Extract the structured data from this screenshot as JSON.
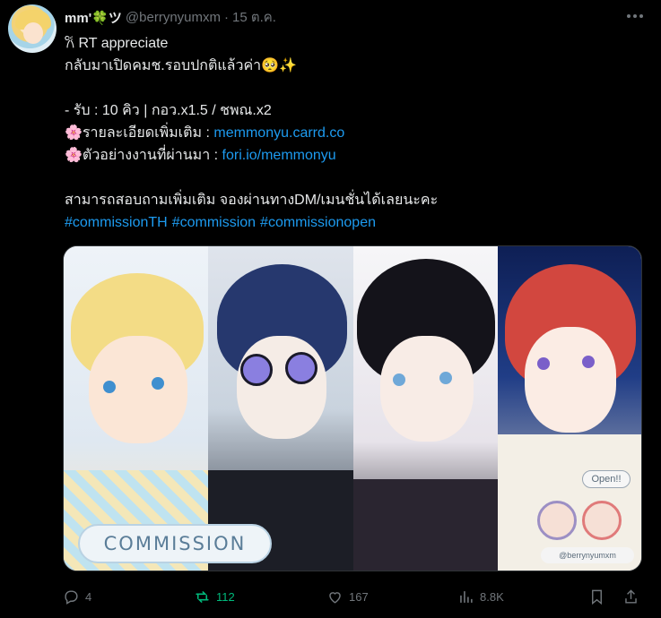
{
  "post": {
    "display_name": "mm'🍀ツ",
    "handle": "@berrynyumxm",
    "separator": "·",
    "date": "15 ต.ค."
  },
  "text": {
    "line1": "𐙚 RT appreciate",
    "line2": "กลับมาเปิดคมช.รอบปกติแล้วค่า🥺✨",
    "line3": "- รับ : 10 คิว | กอว.x1.5 / ชพณ.x2",
    "line4_prefix": "🌸รายละเอียดเพิ่มเติม : ",
    "line4_link": "memmonyu.carrd.co",
    "line5_prefix": "🌸ตัวอย่างงานที่ผ่านมา : ",
    "line5_link": "fori.io/memmonyu",
    "line6": "สามารถสอบถามเพิ่มเติม จองผ่านทางDM/เมนชั่นได้เลยนะคะ",
    "hashtags": [
      "#commissionTH",
      "#commission",
      "#commissionopen"
    ]
  },
  "image": {
    "badge": "COMMISSION",
    "open_label": "Open!!",
    "credit": "@berrynyumxm"
  },
  "actions": {
    "replies": "4",
    "reposts": "112",
    "likes": "167",
    "views": "8.8K"
  },
  "colors": {
    "background": "#000000",
    "text": "#e7e9ea",
    "muted": "#71767b",
    "link": "#1d9bf0",
    "repost_active": "#00ba7c"
  }
}
